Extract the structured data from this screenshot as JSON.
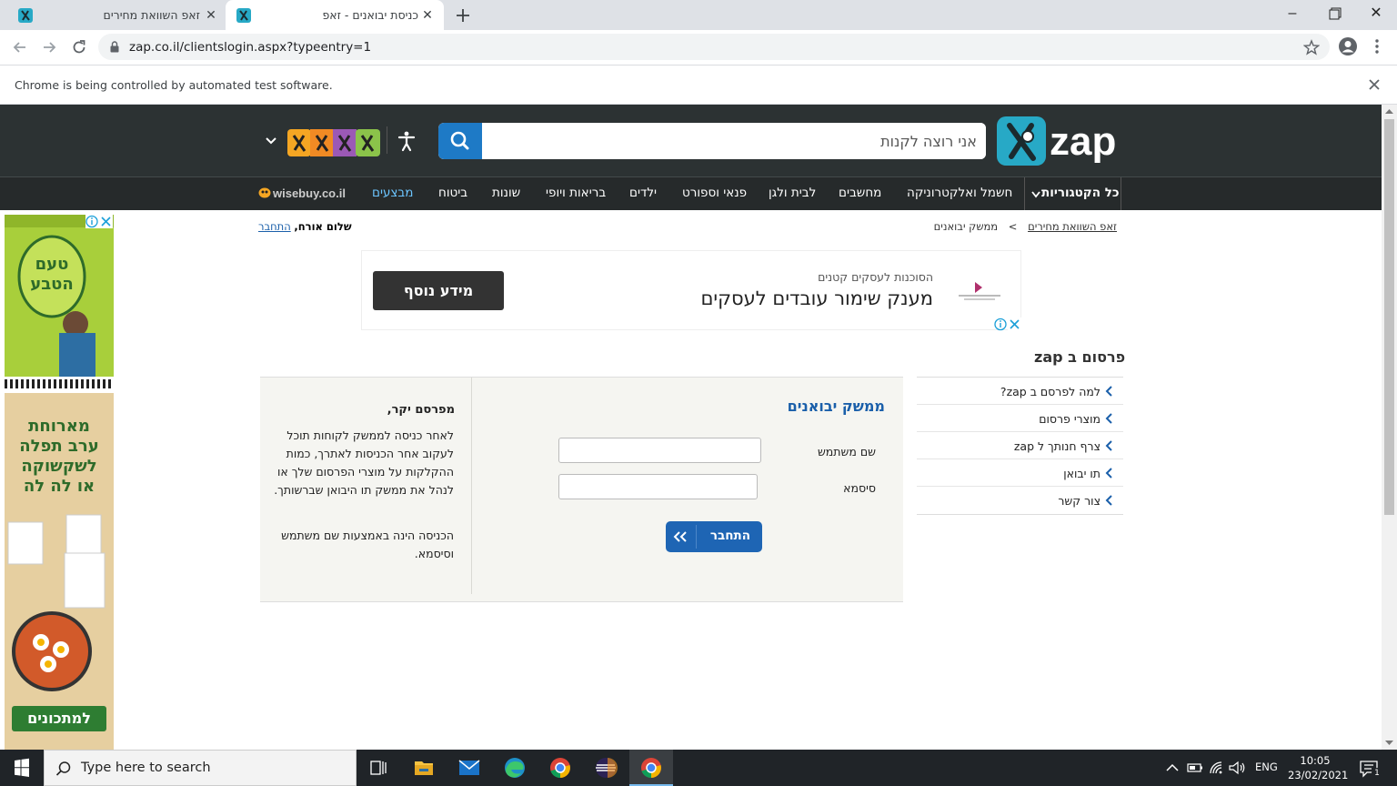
{
  "browser": {
    "tabs": [
      {
        "title": "זאפ השוואת מחירים",
        "active": false
      },
      {
        "title": "כניסת יבואנים - זאפ",
        "active": true
      }
    ],
    "new_tab_icon": "plus-icon",
    "url": "zap.co.il/clientslogin.aspx?typeentry=1",
    "infobar_text": "Chrome is being controlled by automated test software."
  },
  "header": {
    "search_placeholder": "אני רוצה לקנות",
    "logo_text": "zap"
  },
  "nav": {
    "all_categories": "כל הקטגוריות",
    "items": [
      "חשמל ואלקטרוניקה",
      "מחשבים",
      "לבית ולגן",
      "פנאי וספורט",
      "ילדים",
      "בריאות ויופי",
      "שונות",
      "ביטוח",
      "מבצעים"
    ],
    "wisebuy": "wisebuy.co.il"
  },
  "breadcrumb": {
    "home": "זאפ השוואת מחירים",
    "separator": ">",
    "current": "ממשק יבואנים"
  },
  "greeting": {
    "text": "שלום אורח,",
    "login_link": "התחבר"
  },
  "ad_banner": {
    "subtitle": "הסוכנות לעסקים קטנים",
    "headline": "מענק שימור עובדים לעסקים",
    "button": "מידע נוסף"
  },
  "sidebar": {
    "title": "פרסום ב zap",
    "items": [
      "למה לפרסם ב zap?",
      "מוצרי פרסום",
      "צרף חנותך ל zap",
      "תו יבואן",
      "צור קשר"
    ]
  },
  "login": {
    "title": "ממשק יבואנים",
    "username_label": "שם משתמש",
    "password_label": "סיסמא",
    "username_value": "",
    "password_value": "",
    "submit": "התחבר"
  },
  "advertiser_info": {
    "title": "מפרסם יקר,",
    "paragraph1": "לאחר כניסה לממשק לקוחות תוכל לעקוב אחר הכניסות לאתרך, כמות ההקלקות על מוצרי הפרסום שלך או לנהל את ממשק תו היבואן שברשותך.",
    "paragraph2": "הכניסה הינה באמצעות שם משתמש וסיסמא."
  },
  "side_ad": {
    "text1": "מארוחת ערב תפלה לשקשוקה או לה לה",
    "cta": "למתכונים"
  },
  "taskbar": {
    "search_placeholder": "Type here to search",
    "lang": "ENG",
    "time": "10:05",
    "date": "23/02/2021",
    "notification_count": "1"
  },
  "colors": {
    "header_bg": "#2c3233",
    "accent_blue": "#1e7ac6",
    "link_blue": "#1a5faa"
  }
}
